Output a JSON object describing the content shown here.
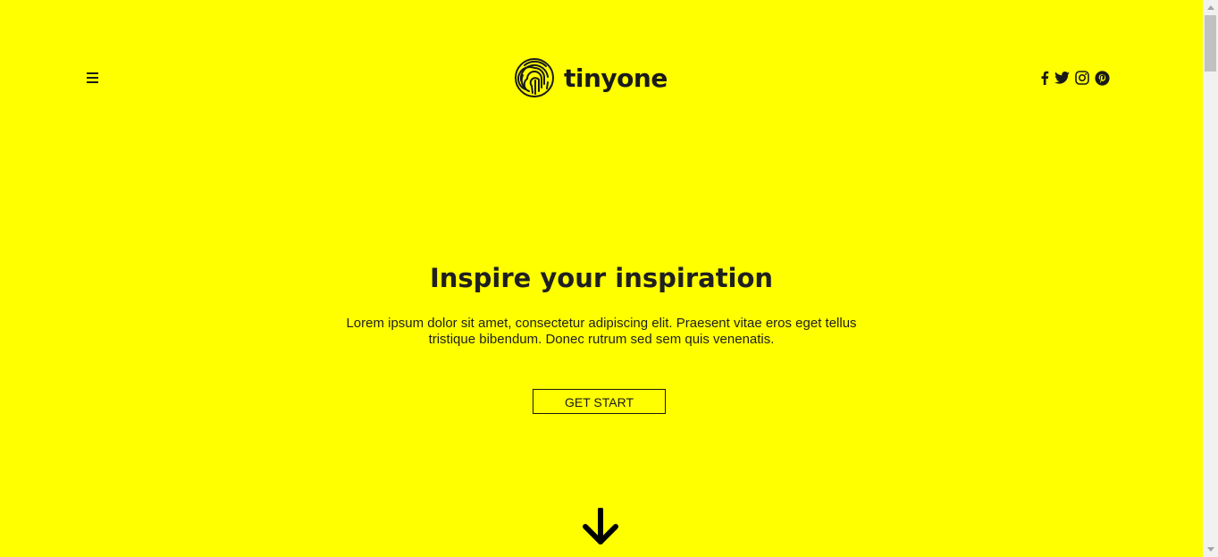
{
  "colors": {
    "background": "#ffff00",
    "text": "#1a1a1a",
    "scrollbar_track": "#f1f1f1",
    "scrollbar_thumb": "#c1c1c1"
  },
  "header": {
    "menu_icon": "hamburger-menu-icon",
    "logo": {
      "icon": "fingerprint-icon",
      "text": "tinyone"
    },
    "social": [
      {
        "name": "facebook",
        "icon": "facebook-icon"
      },
      {
        "name": "twitter",
        "icon": "twitter-icon"
      },
      {
        "name": "instagram",
        "icon": "instagram-icon"
      },
      {
        "name": "pinterest",
        "icon": "pinterest-icon"
      }
    ]
  },
  "hero": {
    "title": "Inspire your inspiration",
    "text_line1": "Lorem ipsum dolor sit amet, consectetur adipiscing elit. Praesent vitae eros eget tellus",
    "text_line2": "tristique bibendum. Donec rutrum sed sem quis venenatis.",
    "cta_label": "GET START",
    "scroll_icon": "arrow-down-icon"
  }
}
